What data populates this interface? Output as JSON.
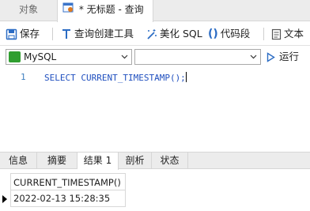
{
  "tabs": {
    "objects_label": "对象",
    "query_label": "* 无标题 - 查询"
  },
  "toolbar": {
    "save_label": "保存",
    "query_builder_label": "查询创建工具",
    "beautify_label": "美化 SQL",
    "snippet_label": "代码段",
    "text_label": "文本"
  },
  "connection": {
    "db_type": "MySQL",
    "database": "",
    "run_label": "运行"
  },
  "editor": {
    "line_number": "1",
    "code": "SELECT CURRENT_TIMESTAMP();"
  },
  "result_tabs": [
    "信息",
    "摘要",
    "结果 1",
    "剖析",
    "状态"
  ],
  "active_result_tab": "结果 1",
  "result": {
    "columns": [
      "CURRENT_TIMESTAMP()"
    ],
    "rows": [
      [
        "2022-02-13 15:28:35"
      ]
    ]
  },
  "colors": {
    "accent_blue": "#1f6fd0",
    "run_green": "#2f9e2f"
  }
}
